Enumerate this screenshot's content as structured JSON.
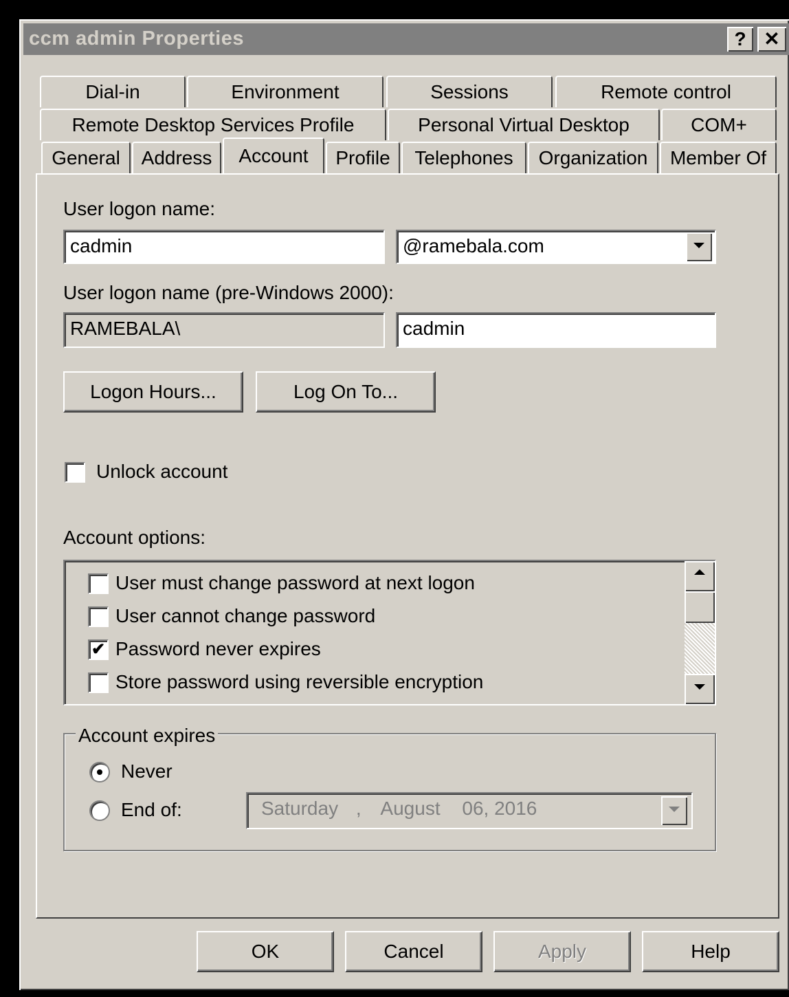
{
  "window": {
    "title": "ccm admin Properties",
    "help_button": "?",
    "close_button": "✕"
  },
  "tabs": {
    "row1": [
      "Dial-in",
      "Environment",
      "Sessions",
      "Remote control"
    ],
    "row2": [
      "Remote Desktop Services Profile",
      "Personal Virtual Desktop",
      "COM+"
    ],
    "row3": [
      "General",
      "Address",
      "Account",
      "Profile",
      "Telephones",
      "Organization",
      "Member Of"
    ],
    "active": "Account"
  },
  "account": {
    "logon_name_label": "User logon name:",
    "logon_name_value": "cadmin",
    "domain_value": "@ramebala.com",
    "pre2000_label": "User logon name (pre-Windows 2000):",
    "pre2000_domain": "RAMEBALA\\",
    "pre2000_name": "cadmin",
    "logon_hours_button": "Logon Hours...",
    "log_on_to_button": "Log On To...",
    "unlock_label": "Unlock account",
    "unlock_checked": false,
    "options_label": "Account options:",
    "options": [
      {
        "label": "User must change password at next logon",
        "checked": false
      },
      {
        "label": "User cannot change password",
        "checked": false
      },
      {
        "label": "Password never expires",
        "checked": true
      },
      {
        "label": "Store password using reversible encryption",
        "checked": false
      }
    ],
    "expires": {
      "group_label": "Account expires",
      "never_label": "Never",
      "end_of_label": "End of:",
      "selected": "Never",
      "date_day": "Saturday",
      "date_sep": ",",
      "date_month": "August",
      "date_rest": "06, 2016"
    }
  },
  "footer": {
    "ok": "OK",
    "cancel": "Cancel",
    "apply": "Apply",
    "help": "Help"
  },
  "colors": {
    "face": "#d4d0c8",
    "titlebar": "#808080",
    "frame": "#000000"
  }
}
